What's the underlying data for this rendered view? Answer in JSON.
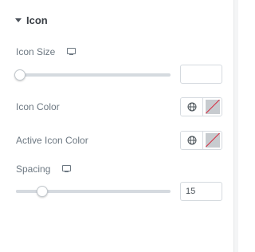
{
  "section": {
    "title": "Icon",
    "caret_icon": "caret-down-icon"
  },
  "icon_size": {
    "label": "Icon Size",
    "device_icon": "desktop-icon",
    "slider_fraction": 0.0,
    "value": ""
  },
  "icon_color": {
    "label": "Icon Color",
    "globe_icon": "globe-icon",
    "swatch_icon": "no-color-swatch-icon"
  },
  "active_icon_color": {
    "label": "Active Icon Color",
    "globe_icon": "globe-icon",
    "swatch_icon": "no-color-swatch-icon"
  },
  "spacing": {
    "label": "Spacing",
    "device_icon": "desktop-icon",
    "slider_fraction": 0.15,
    "value": "15"
  },
  "colors": {
    "track": "#d5dadf",
    "label_text": "#6d7882",
    "title_text": "#3b4046",
    "swatch_fill": "#c7cbcf",
    "swatch_strike": "#d72b3f"
  }
}
